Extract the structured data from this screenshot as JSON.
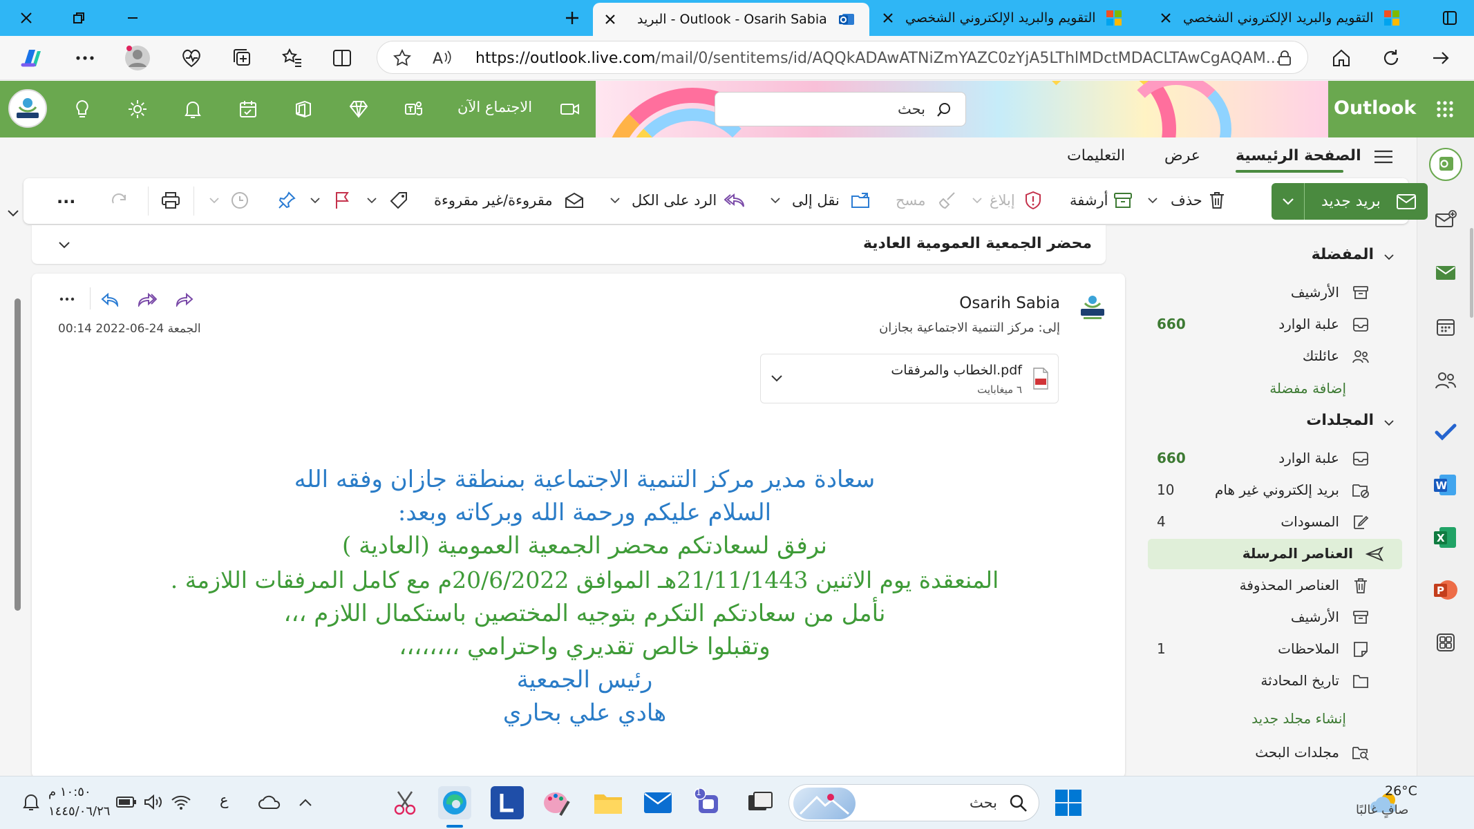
{
  "browser": {
    "tabs": [
      {
        "title": "البريد - Outlook - Osarih Sabia",
        "active": true
      },
      {
        "title": "التقويم والبريد الإلكتروني الشخصي",
        "active": false
      },
      {
        "title": "التقويم والبريد الإلكتروني الشخصي",
        "active": false
      }
    ],
    "url_host": "https://outlook.live.com",
    "url_path": "/mail/0/sentitems/id/AQQkADAwATNiZmYAZC0zYjA5LThlMDctMDACLTAwCgAQAM..."
  },
  "header": {
    "app_title": "Outlook",
    "search_placeholder": "بحث",
    "meet_now": "الاجتماع الآن",
    "brand_color": "#6aa84f"
  },
  "ribbon": {
    "tabs": [
      "الصفحة الرئيسية",
      "عرض",
      "التعليمات"
    ],
    "new_mail": "بريد جديد",
    "delete": "حذف",
    "archive": "أرشفة",
    "report": "إبلاغ",
    "sweep": "مسح",
    "move_to": "نقل إلى",
    "reply_all": "الرد على الكل",
    "read_unread": "مقروءة/غير مقروءة",
    "more": "..."
  },
  "folders": {
    "favorites_header": "المفضلة",
    "favorites": [
      {
        "name": "الأرشيف",
        "icon": "archive-icon",
        "count": ""
      },
      {
        "name": "علبة الوارد",
        "icon": "inbox-icon",
        "count": "660"
      },
      {
        "name": "عائلتك",
        "icon": "people-icon",
        "count": ""
      }
    ],
    "add_favorite": "إضافة مفضلة",
    "folders_header": "المجلدات",
    "items": [
      {
        "name": "علبة الوارد",
        "icon": "inbox-icon",
        "count": "660"
      },
      {
        "name": "بريد إلكتروني غير هام",
        "icon": "junk-icon",
        "count": "10"
      },
      {
        "name": "المسودات",
        "icon": "draft-icon",
        "count": "4"
      },
      {
        "name": "العناصر المرسلة",
        "icon": "send-icon",
        "count": "",
        "selected": true
      },
      {
        "name": "العناصر المحذوفة",
        "icon": "trash-icon",
        "count": ""
      },
      {
        "name": "الأرشيف",
        "icon": "archive-icon",
        "count": ""
      },
      {
        "name": "الملاحظات",
        "icon": "note-icon",
        "count": "1"
      },
      {
        "name": "تاريخ المحادثة",
        "icon": "folder-icon",
        "count": ""
      }
    ],
    "create_folder": "إنشاء مجلد جديد",
    "search_folders": "مجلدات البحث"
  },
  "message": {
    "subject": "محضر الجمعية العمومية العادية",
    "sender": "Osarih Sabia",
    "to_label": "إلى:",
    "to": "مركز التنمية الاجتماعية بجازان",
    "date": "الجمعة 24-06-2022 00:14",
    "attachment_name": "الخطاب والمرفقات.pdf",
    "attachment_size": "٦ ميغابايت",
    "body": [
      {
        "text": "سعادة مدير مركز التنمية الاجتماعية بمنطقة جازان        وفقه الله",
        "color": "blue"
      },
      {
        "text": "السلام عليكم ورحمة الله وبركاته         وبعد:",
        "color": "blue"
      },
      {
        "text": "نرفق لسعادتكم محضر الجمعية العمومية (العادية )",
        "color": "green"
      },
      {
        "text": "المنعقدة يوم الاثنين   21/11/1443هـ الموافق 20/6/2022م مع كامل المرفقات اللازمة .",
        "color": "green"
      },
      {
        "text": "نأمل من سعادتكم التكرم بتوجيه المختصين باستكمال اللازم ،،،",
        "color": "green"
      },
      {
        "text": "وتقبلوا خالص تقديري واحترامي ،،،،،،،،",
        "color": "green"
      },
      {
        "text": "رئيس الجمعية",
        "color": "blue"
      },
      {
        "text": "هادي علي بحاري",
        "color": "blue"
      }
    ]
  },
  "taskbar": {
    "weather_temp": "26°C",
    "weather_text": "صافٍ غالبًا",
    "search_placeholder": "بحث",
    "time": "١٠:٥٠ م",
    "date": "١٤٤٥/٠٦/٢٦",
    "lang": "ع",
    "chat_badge": "1"
  }
}
